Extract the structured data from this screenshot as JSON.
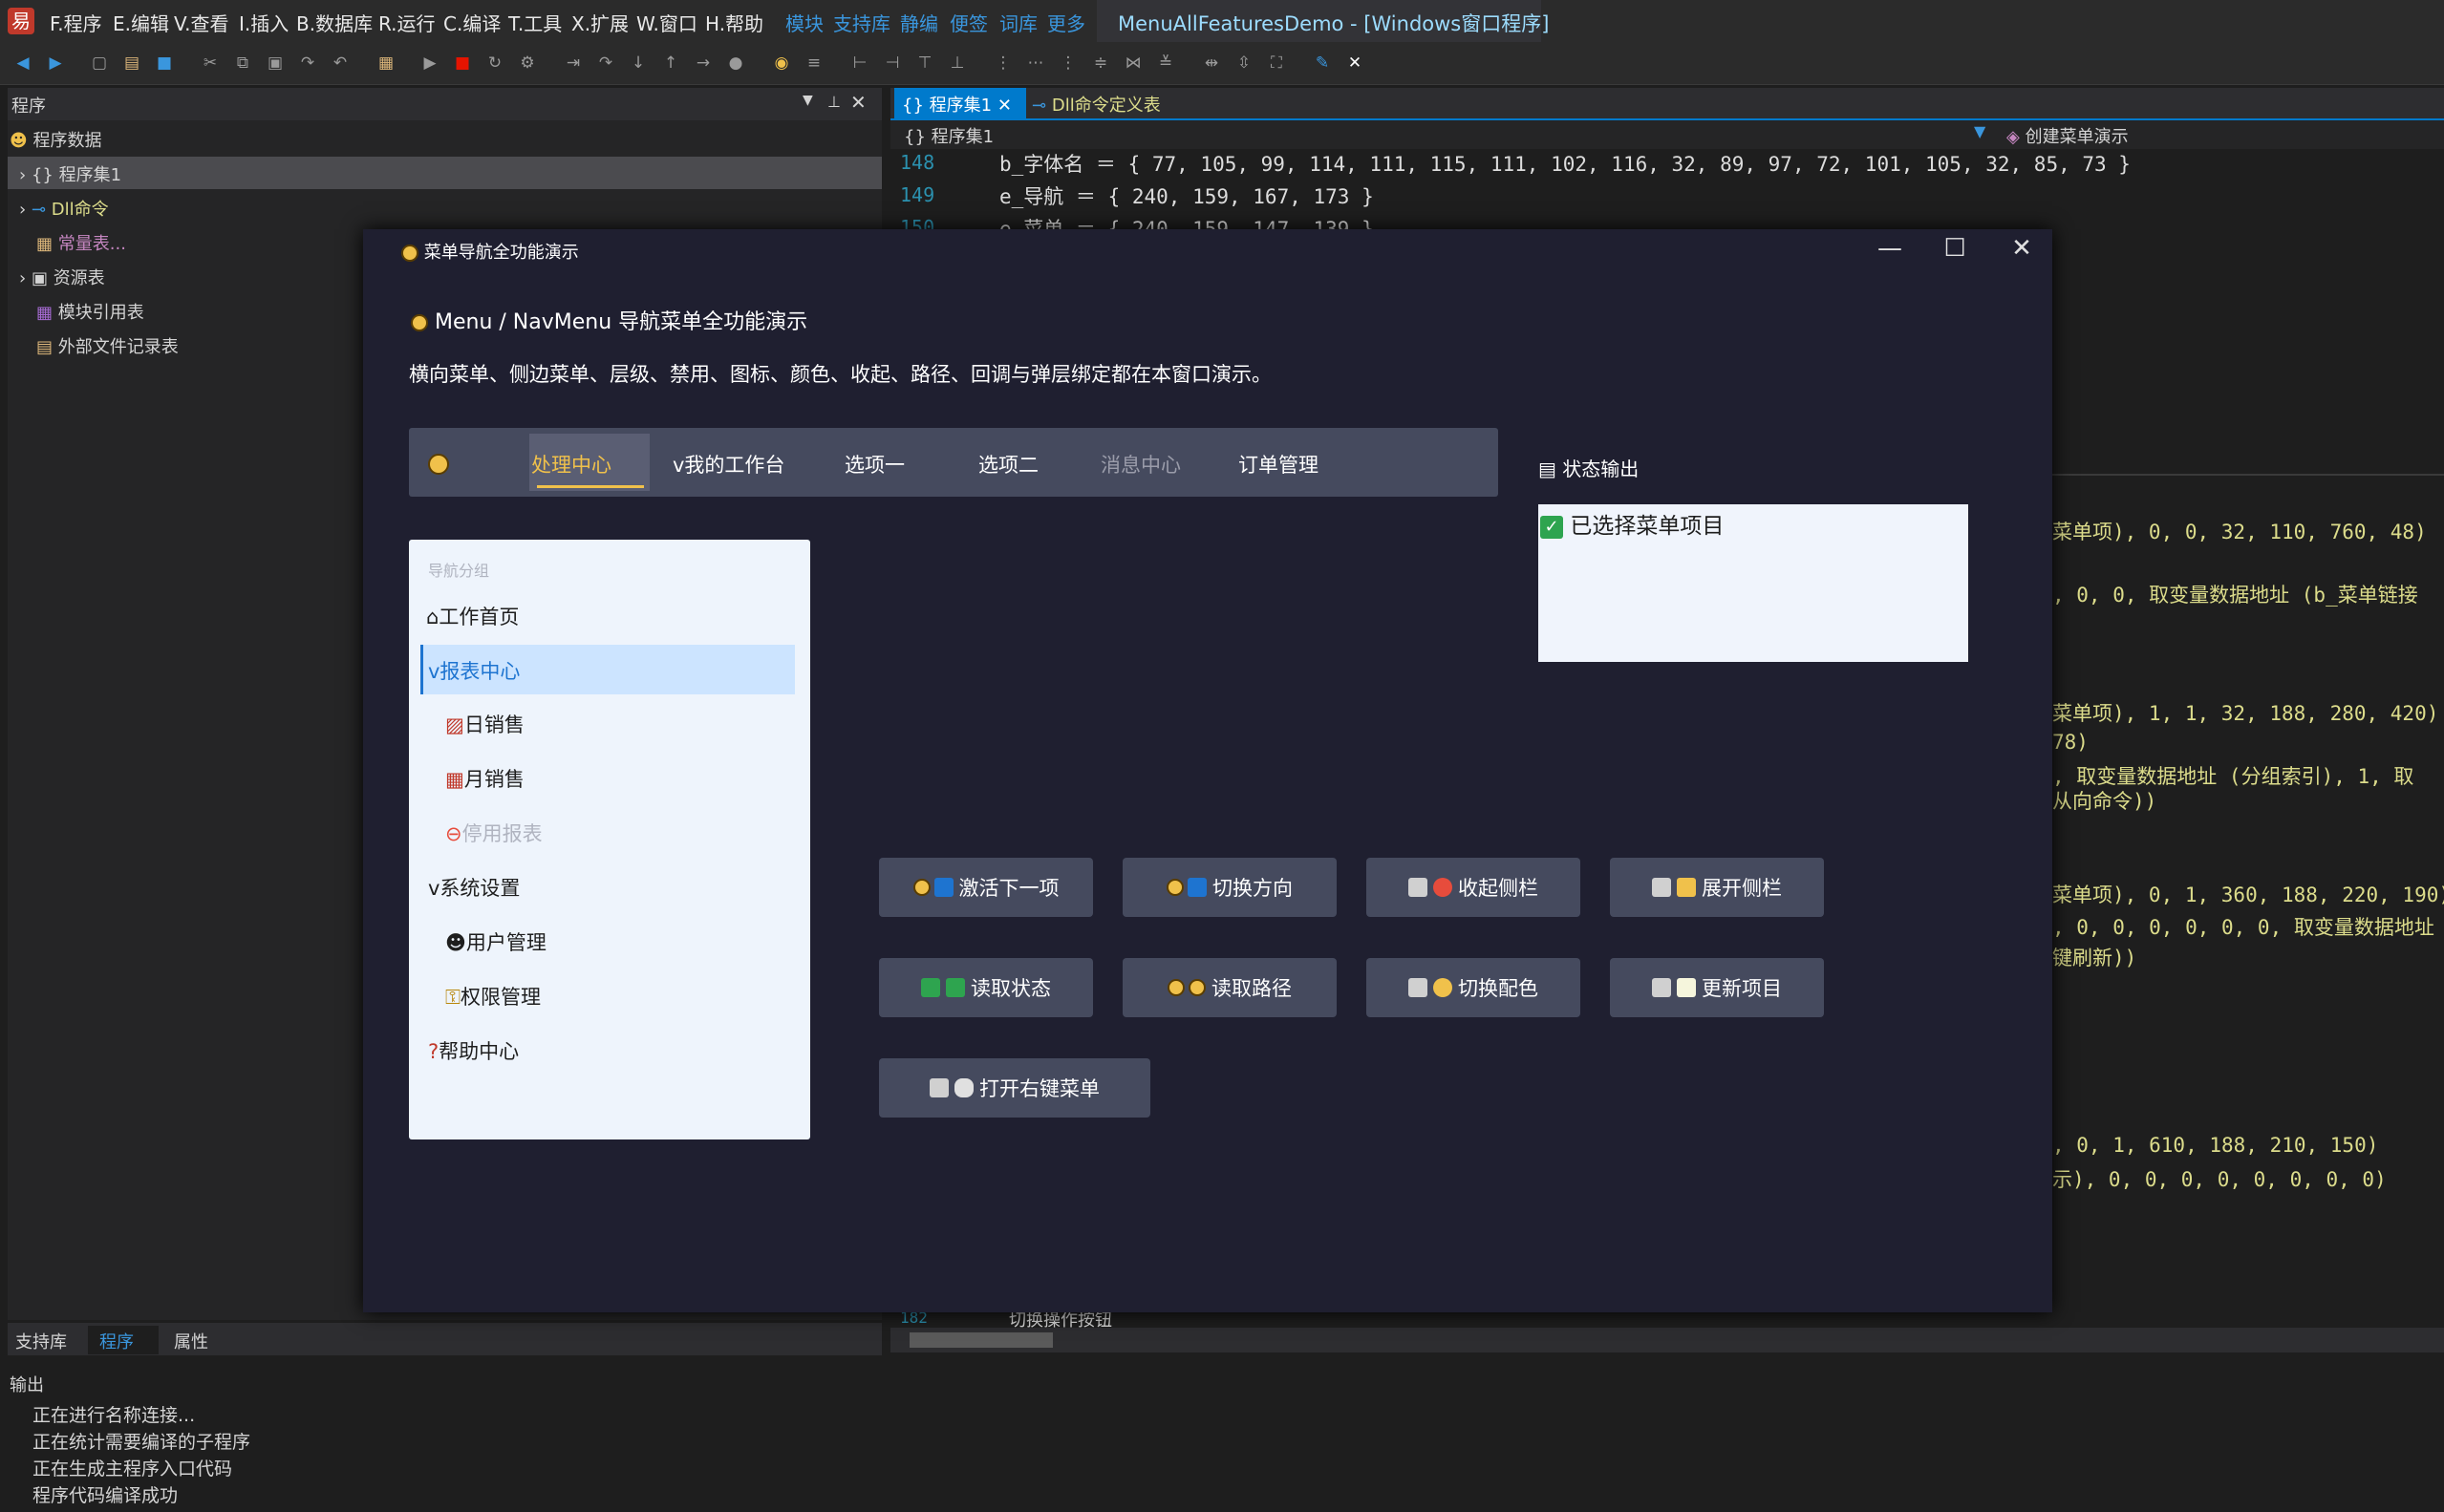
{
  "menubar": {
    "items": [
      "F.程序",
      "E.编辑",
      "V.查看",
      "I.插入",
      "B.数据库",
      "R.运行",
      "C.编译",
      "T.工具",
      "X.扩展",
      "W.窗口",
      "H.帮助"
    ],
    "blue_items": [
      "模块",
      "支持库",
      "静编",
      "便签",
      "词库",
      "更多"
    ],
    "title": "MenuAllFeaturesDemo - [Windows窗口程序]"
  },
  "left_panel": {
    "title": "程序",
    "tree": [
      "程序数据",
      "程序集1",
      "Dll命令",
      "常量表...",
      "资源表",
      "模块引用表",
      "外部文件记录表"
    ],
    "bottom_tabs": [
      "支持库",
      "程序",
      "属性"
    ]
  },
  "editor": {
    "tabs": [
      "程序集1",
      "Dll命令定义表"
    ],
    "breadcrumb": "程序集1",
    "right_dropdown": "创建菜单演示",
    "lines": [
      {
        "ln": "148",
        "text": "b_字体名 ＝ { 77, 105, 99, 114, 111, 115, 111, 102, 116, 32, 89, 97, 72, 101, 105, 32, 85, 73 }"
      },
      {
        "ln": "149",
        "text": "e_导航 ＝ { 240, 159, 167, 173 }"
      },
      {
        "ln": "150",
        "text": "e_菜单 ＝ { 240, 159, 147, 139 }"
      }
    ],
    "right_fragments": [
      "菜单项), 0, 0, 32, 110, 760, 48)",
      ", 0, 0, 取变量数据地址 (b_菜单链接",
      "菜单项), 1, 1, 32, 188, 280, 420)",
      "78)",
      ", 取变量数据地址 (分组索引), 1, 取",
      "从向命令))",
      "菜单项), 0, 1, 360, 188, 220, 190)",
      ", 0, 0, 0, 0, 0, 0, 取变量数据地址",
      "键刷新))",
      ", 0, 1, 610, 188, 210, 150)",
      "示), 0, 0, 0, 0, 0, 0, 0, 0)"
    ],
    "bottom_line": {
      "ln": "182",
      "text": "切换操作按钮"
    }
  },
  "output": {
    "title": "输出",
    "lines": [
      "正在进行名称连接...",
      "正在统计需要编译的子程序",
      "正在生成主程序入口代码",
      "程序代码编译成功"
    ]
  },
  "dialog": {
    "title": "菜单导航全功能演示",
    "heading": "Menu / NavMenu 导航菜单全功能演示",
    "subtitle": "横向菜单、侧边菜单、层级、禁用、图标、颜色、收起、路径、回调与弹层绑定都在本窗口演示。",
    "navbar": [
      "处理中心",
      "v我的工作台",
      "选项一",
      "选项二",
      "消息中心",
      "订单管理"
    ],
    "side_menu": {
      "group_label": "导航分组",
      "items": [
        {
          "label": "工作首页"
        },
        {
          "label": "v报表中心"
        },
        {
          "label": "日销售"
        },
        {
          "label": "月销售"
        },
        {
          "label": "停用报表"
        },
        {
          "label": "v系统设置"
        },
        {
          "label": "用户管理"
        },
        {
          "label": "权限管理"
        },
        {
          "label": "帮助中心"
        }
      ]
    },
    "status_label": "状态输出",
    "status_text": "已选择菜单项目",
    "buttons": [
      "激活下一项",
      "切换方向",
      "收起侧栏",
      "展开侧栏",
      "读取状态",
      "读取路径",
      "切换配色",
      "更新项目",
      "打开右键菜单"
    ]
  },
  "colors": {
    "dialog_bg": "#1f1f30",
    "button_bg": "#454a5e",
    "accent_gold": "#f0c14b",
    "selected_bg": "#cce4ff"
  }
}
